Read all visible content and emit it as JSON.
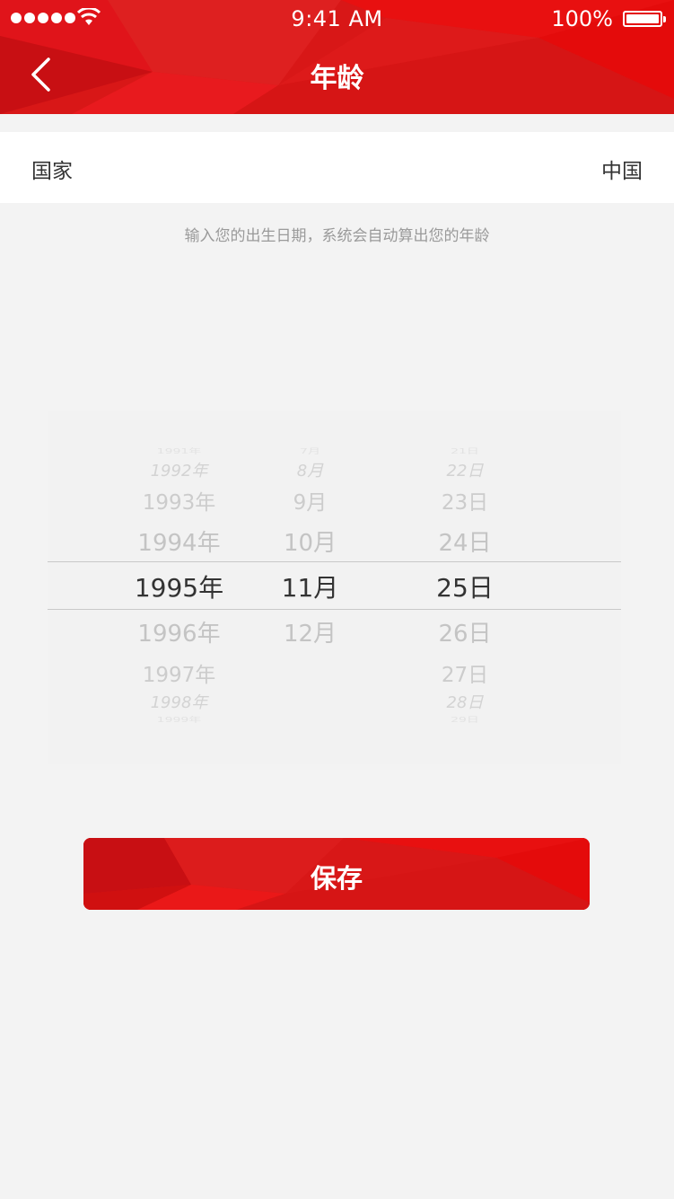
{
  "status_bar": {
    "time": "9:41 AM",
    "battery": "100%"
  },
  "header": {
    "title": "年龄"
  },
  "country_row": {
    "label": "国家",
    "value": "中国"
  },
  "hint": "输入您的出生日期，系统会自动算出您的年龄",
  "picker": {
    "years": [
      "1991年",
      "1992年",
      "1993年",
      "1994年",
      "1995年",
      "1996年",
      "1997年",
      "1998年",
      "1999年"
    ],
    "months": [
      "7月",
      "8月",
      "9月",
      "10月",
      "11月",
      "12月"
    ],
    "days": [
      "21日",
      "22日",
      "23日",
      "24日",
      "25日",
      "26日",
      "27日",
      "28日",
      "29日"
    ],
    "selected": {
      "year": "1995年",
      "month": "11月",
      "day": "25日"
    }
  },
  "save_button": {
    "label": "保存"
  },
  "colors": {
    "brand_red": "#d81717",
    "background": "#f3f3f3",
    "selected_text": "#333333",
    "faded_text": "#c4c4c4"
  }
}
